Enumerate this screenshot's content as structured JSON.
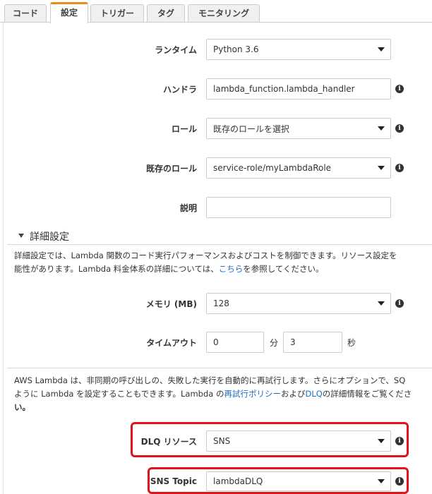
{
  "tabs": [
    {
      "label": "コード",
      "active": false
    },
    {
      "label": "設定",
      "active": true
    },
    {
      "label": "トリガー",
      "active": false
    },
    {
      "label": "タグ",
      "active": false
    },
    {
      "label": "モニタリング",
      "active": false
    }
  ],
  "form": {
    "runtime": {
      "label": "ランタイム",
      "value": "Python 3.6"
    },
    "handler": {
      "label": "ハンドラ",
      "value": "lambda_function.lambda_handler"
    },
    "role": {
      "label": "ロール",
      "value": "既存のロールを選択"
    },
    "existing_role": {
      "label": "既存のロール",
      "value": "service-role/myLambdaRole"
    },
    "description": {
      "label": "説明",
      "value": ""
    }
  },
  "advanced": {
    "title": "詳細設定",
    "desc_line1": "詳細設定では、Lambda 関数のコード実行パフォーマンスおよびコストを制御できます。リソース設定を",
    "desc_line2_a": "能性があります。Lambda 料金体系の詳細については、",
    "desc_line2_link": "こちら",
    "desc_line2_b": "を参照してください。",
    "memory": {
      "label": "メモリ (MB)",
      "value": "128"
    },
    "timeout": {
      "label": "タイムアウト",
      "minutes": "0",
      "minutes_unit": "分",
      "seconds": "3",
      "seconds_unit": "秒"
    }
  },
  "retry": {
    "line1": "AWS Lambda は、非同期の呼び出しの、失敗した実行を自動的に再試行します。さらにオプションで、SQ",
    "line2_a": "ように Lambda を設定することもできます。Lambda の",
    "line2_link1": "再試行ポリシー",
    "line2_b": "および",
    "line2_link2": "DLQ",
    "line2_c": "の詳細情報をご覧くださ",
    "line3": "い。",
    "dlq_resource": {
      "label": "DLQ リソース",
      "value": "SNS"
    },
    "sns_topic": {
      "label": "SNS Topic",
      "value": "lambdaDLQ"
    }
  },
  "colors": {
    "highlight": "#e0131c",
    "tab_accent": "#ec8b1c",
    "link": "#1a6fc4"
  },
  "icons": {
    "info": "info-icon",
    "caret": "chevron-down-icon"
  }
}
